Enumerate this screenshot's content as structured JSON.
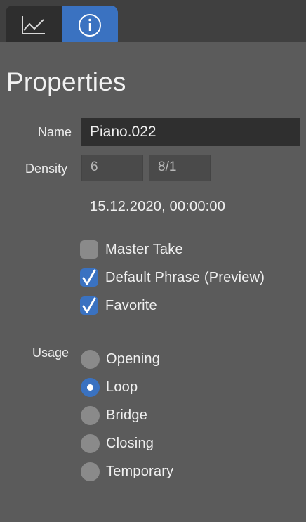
{
  "tabs": [
    {
      "name": "chart",
      "icon": "line-chart-icon",
      "selected": false
    },
    {
      "name": "info",
      "icon": "info-icon",
      "selected": true
    }
  ],
  "colors": {
    "accent": "#3a72c1",
    "background": "#5b5b5b",
    "tabbar": "#404040",
    "field": "#2f2f2f"
  },
  "properties": {
    "title": "Properties",
    "name_label": "Name",
    "name_value": "Piano.022",
    "density_label": "Density",
    "density_value": "6",
    "ratio_value": "8/1",
    "timestamp": "15.12.2020, 00:00:00"
  },
  "checkboxes": [
    {
      "label": "Master Take",
      "checked": false
    },
    {
      "label": "Default Phrase (Preview)",
      "checked": true
    },
    {
      "label": "Favorite",
      "checked": true
    }
  ],
  "usage": {
    "label": "Usage",
    "selected": "Loop",
    "options": [
      "Opening",
      "Loop",
      "Bridge",
      "Closing",
      "Temporary"
    ]
  }
}
